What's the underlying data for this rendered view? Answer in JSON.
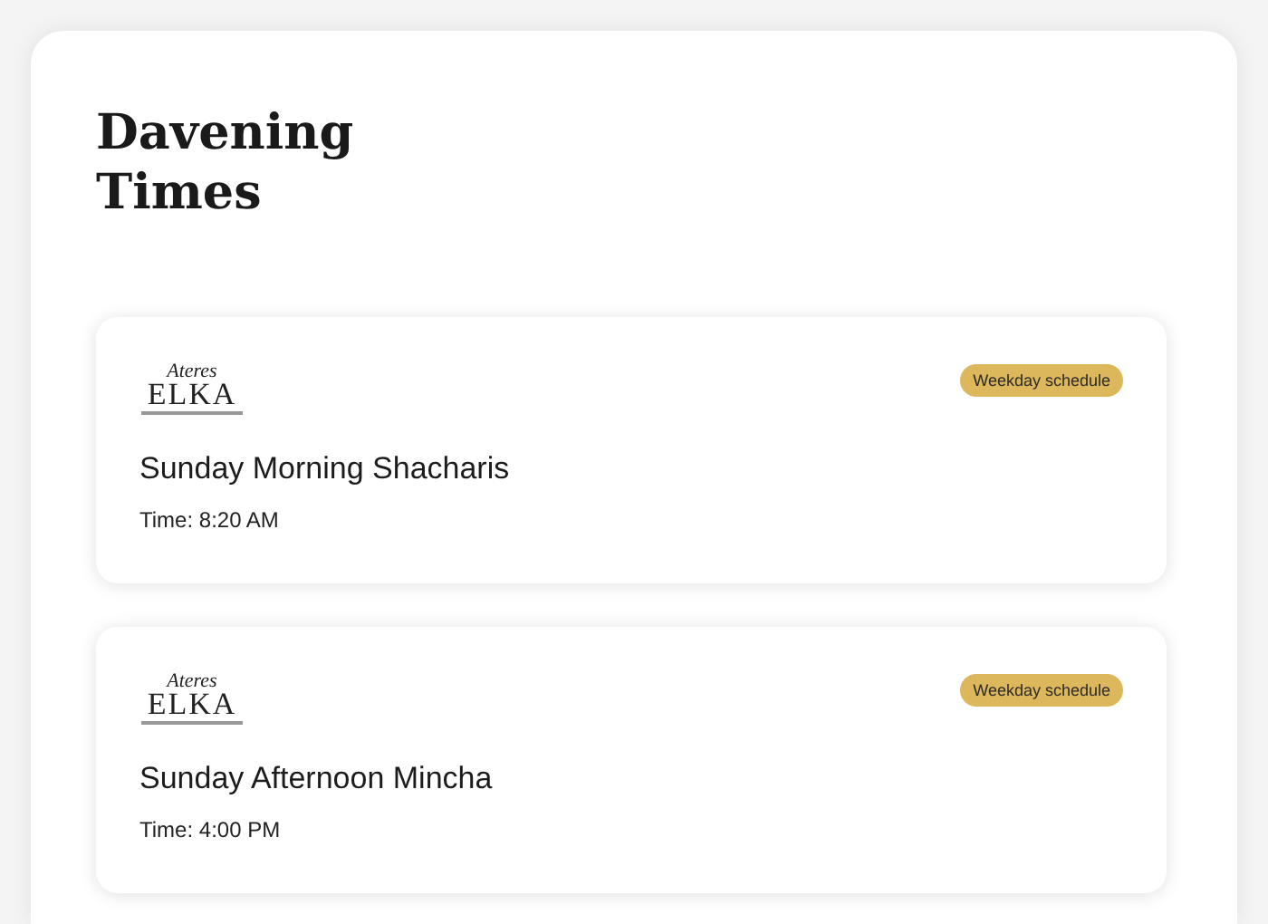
{
  "title": "Davening Times",
  "entries": [
    {
      "logo": {
        "script": "Ateres",
        "main": "ELKA"
      },
      "badge": "Weekday schedule",
      "name": "Sunday Morning Shacharis",
      "time": "Time: 8:20 AM"
    },
    {
      "logo": {
        "script": "Ateres",
        "main": "ELKA"
      },
      "badge": "Weekday schedule",
      "name": "Sunday Afternoon Mincha",
      "time": "Time: 4:00 PM"
    }
  ]
}
